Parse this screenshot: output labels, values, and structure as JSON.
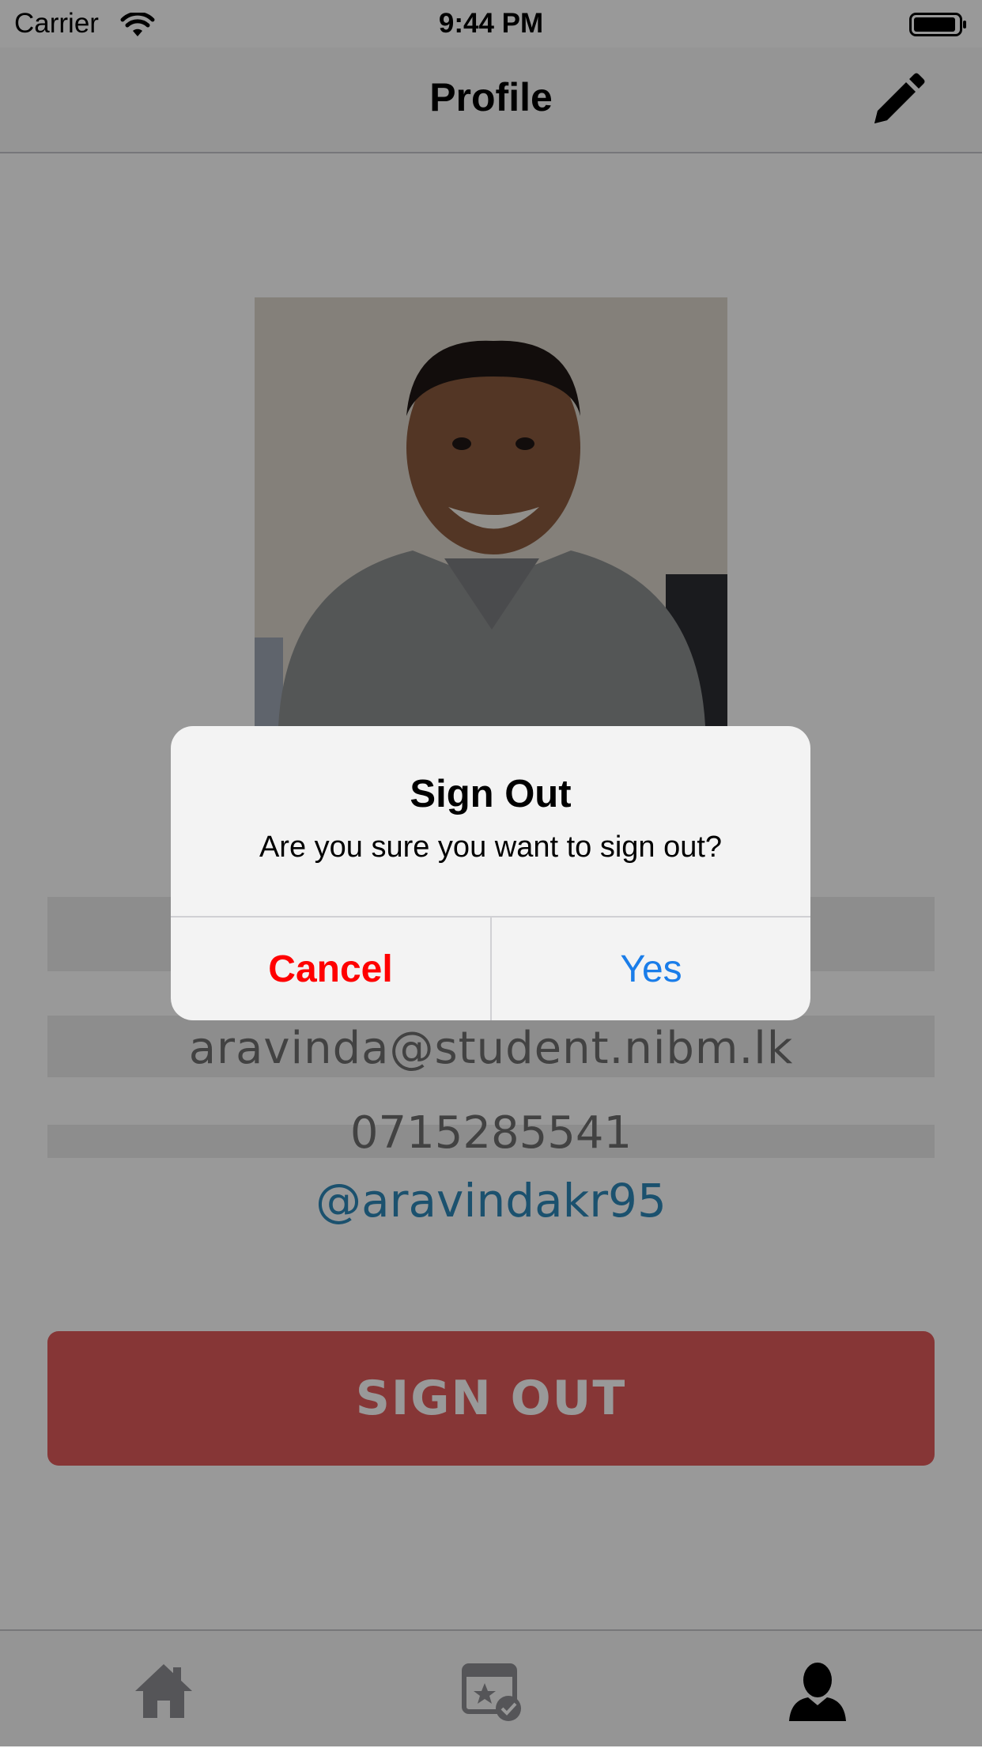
{
  "status_bar": {
    "carrier": "Carrier",
    "time": "9:44 PM"
  },
  "nav": {
    "title": "Profile",
    "edit_icon": "pencil-icon"
  },
  "profile": {
    "photo_alt": "profile-photo",
    "email": "aravinda@student.nibm.lk",
    "phone": "0715285541",
    "twitter": "@aravindakr95",
    "signout_label": "SIGN OUT"
  },
  "tab_bar": {
    "items": [
      {
        "icon": "home-icon"
      },
      {
        "icon": "event-calendar-icon"
      },
      {
        "icon": "profile-icon"
      }
    ]
  },
  "alert": {
    "title": "Sign Out",
    "message": "Are you sure you want to sign out?",
    "cancel_label": "Cancel",
    "yes_label": "Yes"
  },
  "colors": {
    "signout": "#e05a5a",
    "cancel": "#ff0000",
    "yes": "#1a7de9",
    "twitter": "#2d87b8"
  }
}
